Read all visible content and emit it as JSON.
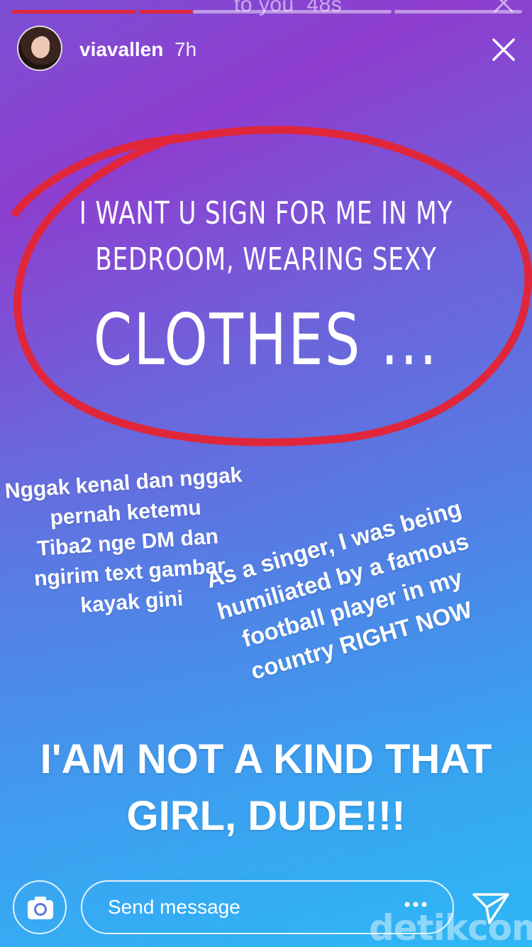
{
  "colors": {
    "accent_red": "#e0263a",
    "text": "#ffffff"
  },
  "ghost_header": {
    "text": "to you",
    "time": "48s"
  },
  "header": {
    "username": "viavallen",
    "time": "7h",
    "close_icon": "close-icon"
  },
  "story": {
    "quote_line1": "I WANT U SIGN FOR ME IN MY",
    "quote_line2": "BEDROOM, WEARING SEXY",
    "quote_line3": "CLOTHES ...",
    "caption_left": [
      "Nggak kenal dan nggak",
      "pernah ketemu",
      "Tiba2 nge DM dan",
      "ngirim text gambar",
      "kayak gini"
    ],
    "caption_right": [
      "As a singer, I was being",
      "humiliated by a famous",
      "football player in my",
      "country RIGHT NOW"
    ],
    "caption_big": [
      "I'AM NOT A KIND THAT",
      "GIRL, DUDE!!!"
    ]
  },
  "bottom_bar": {
    "camera_icon": "camera-icon",
    "message_placeholder": "Send message",
    "more_icon": "more-icon",
    "send_icon": "send-icon"
  },
  "watermark": "detikcom"
}
